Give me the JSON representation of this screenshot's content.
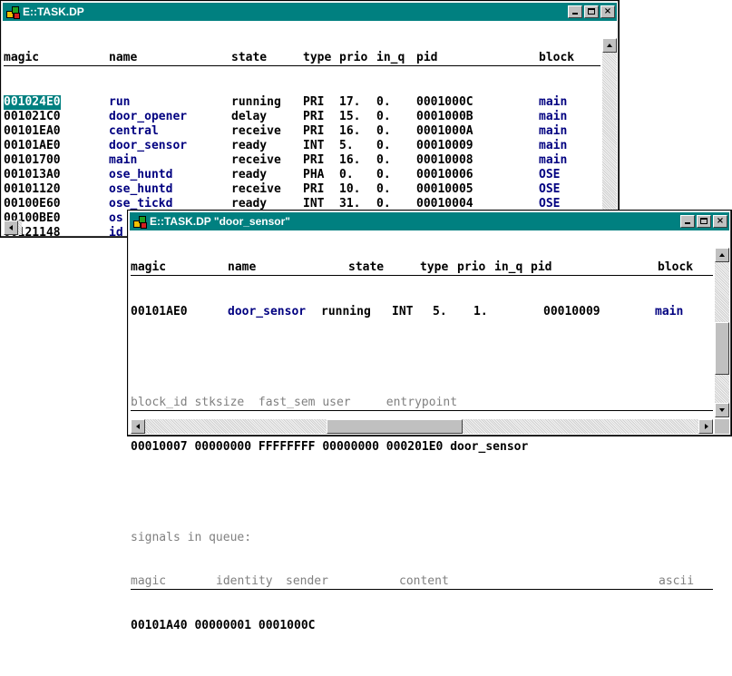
{
  "window1": {
    "title": "E::TASK.DP",
    "columns": [
      "magic",
      "name",
      "state",
      "type",
      "prio",
      "in_q",
      "pid",
      "block"
    ],
    "rows": [
      [
        "001024E0",
        "run",
        "running",
        "PRI",
        "17.",
        "0.",
        "0001000C",
        "main"
      ],
      [
        "001021C0",
        "door_opener",
        "delay",
        "PRI",
        "15.",
        "0.",
        "0001000B",
        "main"
      ],
      [
        "00101EA0",
        "central",
        "receive",
        "PRI",
        "16.",
        "0.",
        "0001000A",
        "main"
      ],
      [
        "00101AE0",
        "door_sensor",
        "ready",
        "INT",
        "5.",
        "0.",
        "00010009",
        "main"
      ],
      [
        "00101700",
        "main",
        "receive",
        "PRI",
        "16.",
        "0.",
        "00010008",
        "main"
      ],
      [
        "001013A0",
        "ose_huntd",
        "ready",
        "PHA",
        "0.",
        "0.",
        "00010006",
        "OSE"
      ],
      [
        "00101120",
        "ose_huntd",
        "receive",
        "PRI",
        "10.",
        "0.",
        "00010005",
        "OSE"
      ],
      [
        "00100E60",
        "ose_tickd",
        "ready",
        "INT",
        "31.",
        "0.",
        "00010004",
        "OSE"
      ],
      [
        "00100BE0",
        "os",
        "",
        "",
        "",
        "",
        "",
        ""
      ],
      [
        "00121148",
        "id",
        "",
        "",
        "",
        "",
        "",
        ""
      ]
    ],
    "selected_row": 0
  },
  "window2": {
    "title": "E::TASK.DP \"door_sensor\"",
    "columns": [
      "magic",
      "name",
      "state",
      "type",
      "prio",
      "in_q",
      "pid",
      "block"
    ],
    "task": [
      "00101AE0",
      "door_sensor",
      "running",
      "INT",
      "5.",
      "1.",
      "00010009",
      "main"
    ],
    "detail_header": "block_id stksize  fast_sem user     entrypoint",
    "detail_values": "00010007 00000000 FFFFFFFF 00000000 000201E0 door_sensor",
    "signals_label": "signals in queue:",
    "signals_header": [
      "magic",
      "identity",
      "sender",
      "content",
      "ascii"
    ],
    "signals_row": "00101A40 00000001 0001000C"
  },
  "colors": {
    "title_bg": "#008080",
    "value_blue": "#000080",
    "header_gray": "#808080"
  }
}
